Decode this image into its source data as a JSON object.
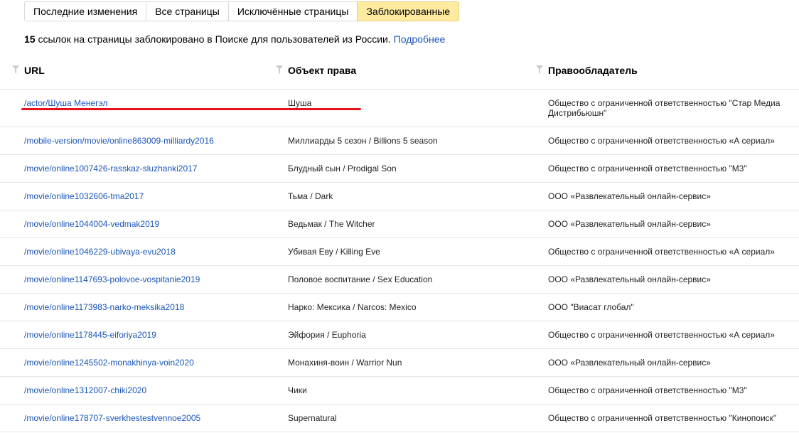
{
  "tabs": [
    {
      "label": "Последние изменения",
      "active": false
    },
    {
      "label": "Все страницы",
      "active": false
    },
    {
      "label": "Исключённые страницы",
      "active": false
    },
    {
      "label": "Заблокированные",
      "active": true
    }
  ],
  "summary": {
    "count": "15",
    "text": " ссылок на страницы заблокировано в Поиске для пользователей из России. ",
    "link": "Подробнее"
  },
  "columns": {
    "url": "URL",
    "object": "Объект права",
    "owner": "Правообладатель"
  },
  "colors": {
    "link": "#1a55b8",
    "active_tab": "#ffeba0",
    "annotation": "#e8101a"
  },
  "rows": [
    {
      "url": "/actor/Шуша Менегэл",
      "object": "Шуша",
      "owner": "Общество с ограниченной ответственностью \"Стар Медиа Дистрибьюшн\""
    },
    {
      "url": "/mobile-version/movie/online863009-milliardy2016",
      "object": "Миллиарды 5 сезон / Billions 5 season",
      "owner": "Общество с ограниченной ответственностью «А сериал»"
    },
    {
      "url": "/movie/online1007426-rasskaz-sluzhanki2017",
      "object": "Блудный сын / Prodigal Son",
      "owner": "Общество с ограниченной ответственностью \"М3\""
    },
    {
      "url": "/movie/online1032606-tma2017",
      "object": "Тьма / Dark",
      "owner": "ООО «Развлекательный онлайн-сервис»"
    },
    {
      "url": "/movie/online1044004-vedmak2019",
      "object": "Ведьмак / The Witcher",
      "owner": "ООО «Развлекательный онлайн-сервис»"
    },
    {
      "url": "/movie/online1046229-ubivaya-evu2018",
      "object": "Убивая Еву / Killing Eve",
      "owner": "Общество с ограниченной ответственностью «А сериал»"
    },
    {
      "url": "/movie/online1147693-polovoe-vospitanie2019",
      "object": "Половое воспитание / Sex Education",
      "owner": "ООО «Развлекательный онлайн-сервис»"
    },
    {
      "url": "/movie/online1173983-narko-meksika2018",
      "object": "Нарко: Мексика / Narcos: Mexico",
      "owner": "ООО \"Виасат глобал\""
    },
    {
      "url": "/movie/online1178445-eiforiya2019",
      "object": "Эйфория / Euphoria",
      "owner": "Общество с ограниченной ответственностью «А сериал»"
    },
    {
      "url": "/movie/online1245502-monakhinya-voin2020",
      "object": "Монахиня-воин / Warrior Nun",
      "owner": "ООО «Развлекательный онлайн-сервис»"
    },
    {
      "url": "/movie/online1312007-chiki2020",
      "object": "Чики",
      "owner": "Общество с ограниченной ответственностью \"М3\""
    },
    {
      "url": "/movie/online178707-sverkhestestvennoe2005",
      "object": "Supernatural",
      "owner": "Общество с ограниченной ответственностью \"Кинопоиск\""
    }
  ]
}
